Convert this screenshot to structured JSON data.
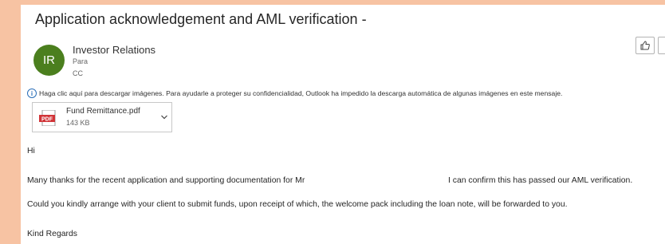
{
  "email": {
    "subject": "Application acknowledgement and AML verification -",
    "avatar_initials": "IR",
    "avatar_color": "#4b7f1e",
    "sender_name": "Investor Relations",
    "to_label": "Para",
    "cc_label": "CC",
    "info_message": "Haga clic aquí para descargar imágenes. Para ayudarle a proteger su confidencialidad, Outlook ha impedido la descarga automática de algunas imágenes en este mensaje.",
    "info_icon": "i",
    "attachment": {
      "icon": "pdf-icon",
      "icon_text": "PDF",
      "name": "Fund Remittance.pdf",
      "size": "143 KB"
    },
    "actions": {
      "like_icon": "thumbs-up-icon",
      "more_icon": "button"
    },
    "body": {
      "greeting": "Hi",
      "line1_part1": "Many thanks for the recent application and supporting documentation for Mr",
      "line1_part2": "I can confirm this has passed our AML verification.",
      "line2": "Could you kindly arrange with your client to submit funds, upon receipt of which, the welcome pack including the loan note, will be forwarded to you.",
      "signoff": "Kind Regards"
    }
  }
}
